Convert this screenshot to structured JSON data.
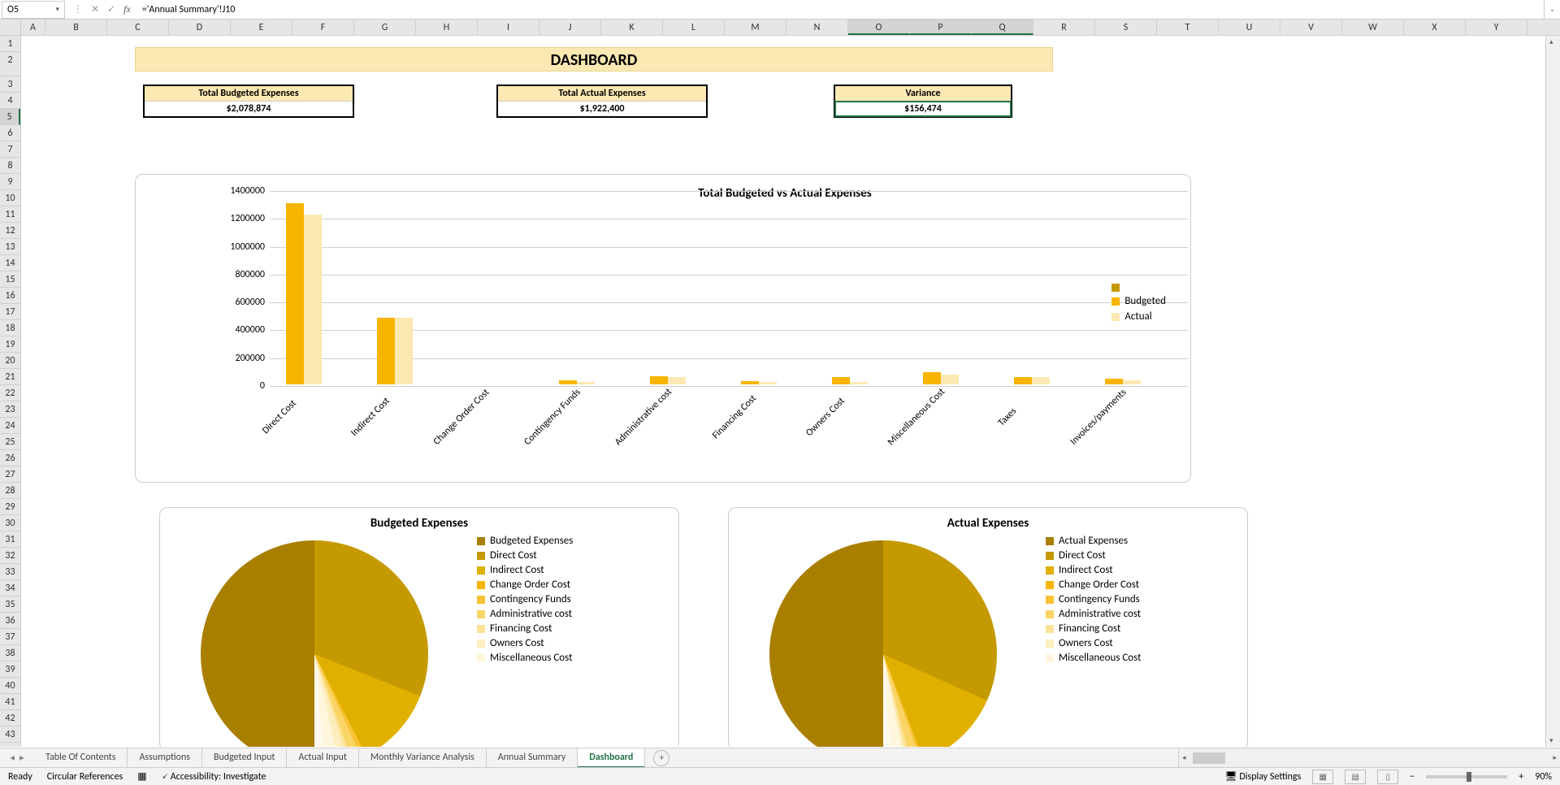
{
  "formula_bar": {
    "name_box": "O5",
    "formula": "='Annual Summary'!J10"
  },
  "columns": [
    "A",
    "B",
    "C",
    "D",
    "E",
    "F",
    "G",
    "H",
    "I",
    "J",
    "K",
    "L",
    "M",
    "N",
    "O",
    "P",
    "Q",
    "R",
    "S",
    "T",
    "U",
    "V",
    "W",
    "X",
    "Y"
  ],
  "selected_cols": [
    "O",
    "P",
    "Q"
  ],
  "rows_count": 43,
  "big_row": 2,
  "selected_row": 5,
  "dashboard": {
    "title": "DASHBOARD",
    "metrics": [
      {
        "label": "Total Budgeted Expenses",
        "value": "$2,078,874"
      },
      {
        "label": "Total Actual Expenses",
        "value": "$1,922,400"
      },
      {
        "label": "Variance",
        "value": "$156,474"
      }
    ]
  },
  "chart_data": [
    {
      "type": "bar",
      "title": "Total Budgeted vs Actual Expenses",
      "categories": [
        "Direct Cost",
        "Indirect Cost",
        "Change Order Cost",
        "Contingency Funds",
        "Administrative cost",
        "Financing Cost",
        "Owners Cost",
        "Miscellaneous Cost",
        "Taxes",
        "Invoices/payments"
      ],
      "series": [
        {
          "name": "Budgeted",
          "color": "#f7b500",
          "values": [
            1300000,
            480000,
            0,
            30000,
            60000,
            25000,
            55000,
            85000,
            55000,
            40000
          ]
        },
        {
          "name": "Actual",
          "color": "#fce8b2",
          "values": [
            1220000,
            480000,
            0,
            15000,
            55000,
            20000,
            15000,
            70000,
            55000,
            30000
          ]
        }
      ],
      "ylim": [
        0,
        1400000
      ],
      "yticks": [
        0,
        200000,
        400000,
        600000,
        800000,
        1000000,
        1200000,
        1400000
      ],
      "legend": [
        {
          "name": "",
          "color": "#c49a00"
        },
        {
          "name": "Budgeted",
          "color": "#f7b500"
        },
        {
          "name": "Actual",
          "color": "#fce8b2"
        }
      ]
    },
    {
      "type": "pie",
      "title": "Budgeted Expenses",
      "legend": [
        {
          "name": "Budgeted Expenses",
          "color": "#a97f00"
        },
        {
          "name": "Direct Cost",
          "color": "#c49a00"
        },
        {
          "name": "Indirect Cost",
          "color": "#e0b000"
        },
        {
          "name": "Change Order Cost",
          "color": "#f7b500"
        },
        {
          "name": "Contingency Funds",
          "color": "#f9c233"
        },
        {
          "name": "Administrative cost",
          "color": "#fbd466"
        },
        {
          "name": "Financing Cost",
          "color": "#fce398"
        },
        {
          "name": "Owners Cost",
          "color": "#fdeec0"
        },
        {
          "name": "Miscellaneous Cost",
          "color": "#fff6dd"
        }
      ],
      "slices": [
        50,
        31,
        11.5,
        0,
        0.7,
        1.4,
        0.6,
        1.3,
        2.0,
        1.3,
        1.0
      ]
    },
    {
      "type": "pie",
      "title": "Actual Expenses",
      "legend": [
        {
          "name": "Actual Expenses",
          "color": "#a97f00"
        },
        {
          "name": "Direct Cost",
          "color": "#c49a00"
        },
        {
          "name": "Indirect Cost",
          "color": "#e0b000"
        },
        {
          "name": "Change Order Cost",
          "color": "#f7b500"
        },
        {
          "name": "Contingency Funds",
          "color": "#f9c233"
        },
        {
          "name": "Administrative cost",
          "color": "#fbd466"
        },
        {
          "name": "Financing Cost",
          "color": "#fce398"
        },
        {
          "name": "Owners Cost",
          "color": "#fdeec0"
        },
        {
          "name": "Miscellaneous Cost",
          "color": "#fff6dd"
        }
      ],
      "slices": [
        50,
        31.7,
        12.5,
        0,
        0.4,
        1.4,
        0.5,
        0.4,
        1.8,
        1.4,
        0.8
      ]
    }
  ],
  "tabs": {
    "items": [
      "Table Of Contents",
      "Assumptions",
      "Budgeted Input",
      "Actual Input",
      "Monthly Variance Analysis",
      "Annual Summary",
      "Dashboard"
    ],
    "active": "Dashboard"
  },
  "status": {
    "ready": "Ready",
    "circular": "Circular References",
    "accessibility": "Accessibility: Investigate",
    "display": "Display Settings",
    "zoom": "90%"
  }
}
